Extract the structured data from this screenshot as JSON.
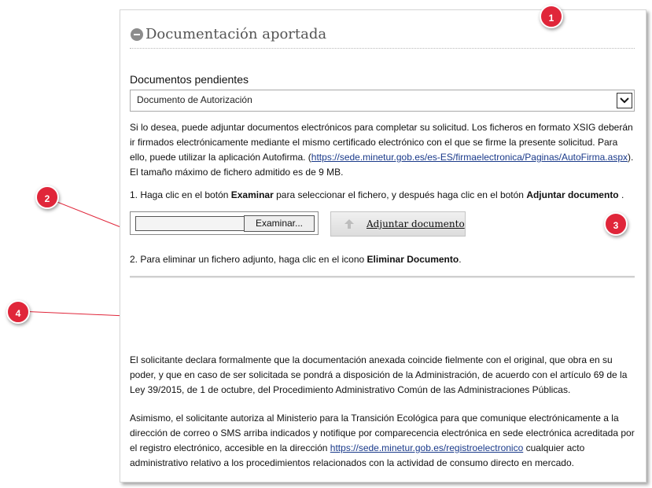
{
  "section": {
    "title": "Documentación aportada"
  },
  "pending": {
    "label": "Documentos pendientes",
    "selected": "Documento de Autorización"
  },
  "intro": {
    "text": "Si lo desea, puede adjuntar documentos electrónicos para completar su solicitud. Los ficheros en formato XSIG deberán ir firmados electrónicamente mediante el mismo certificado electrónico con el que se firme la presente solicitud. Para ello, puede utilizar la aplicación Autofirma. (",
    "link": "https://sede.minetur.gob.es/es-ES/firmaelectronica/Paginas/AutoFirma.aspx",
    "after_link": ").",
    "max_size": "El tamaño máximo de fichero admitido es de 9 MB."
  },
  "step1": {
    "prefix": "1. Haga clic en el botón ",
    "bold1": "Examinar",
    "middle": " para seleccionar el fichero, y después haga clic en el botón ",
    "bold2": "Adjuntar documento",
    "suffix": " ."
  },
  "file_upload": {
    "browse_label": "Examinar...",
    "attach_label": "Adjuntar documento"
  },
  "step2": {
    "prefix": "2. Para eliminar un fichero adjunto, haga clic en el icono ",
    "bold": "Eliminar Documento",
    "suffix": "."
  },
  "declaration": {
    "text": "El solicitante declara formalmente que la documentación anexada coincide fielmente con el original, que obra en su poder, y que en caso de ser solicitada se pondrá a disposición de la Administración, de acuerdo con el artículo 69 de la Ley 39/2015, de 1 de octubre, del Procedimiento Administrativo Común de las Administraciones Públicas."
  },
  "authorization": {
    "prefix": "Asimismo, el solicitante autoriza al Ministerio para la Transición Ecológica para que comunique electrónicamente a la dirección de correo o SMS arriba indicados y notifique por comparecencia electrónica en sede electrónica acreditada por el registro electrónico, accesible en la dirección ",
    "link": "https://sede.minetur.gob.es/registroelectronico",
    "suffix": " cualquier acto administrativo relativo a los procedimientos relacionados con la actividad de consumo directo en mercado."
  },
  "callouts": [
    "1",
    "2",
    "3",
    "4"
  ],
  "colors": {
    "callout": "#e0263a",
    "link": "#1a3a8a"
  }
}
